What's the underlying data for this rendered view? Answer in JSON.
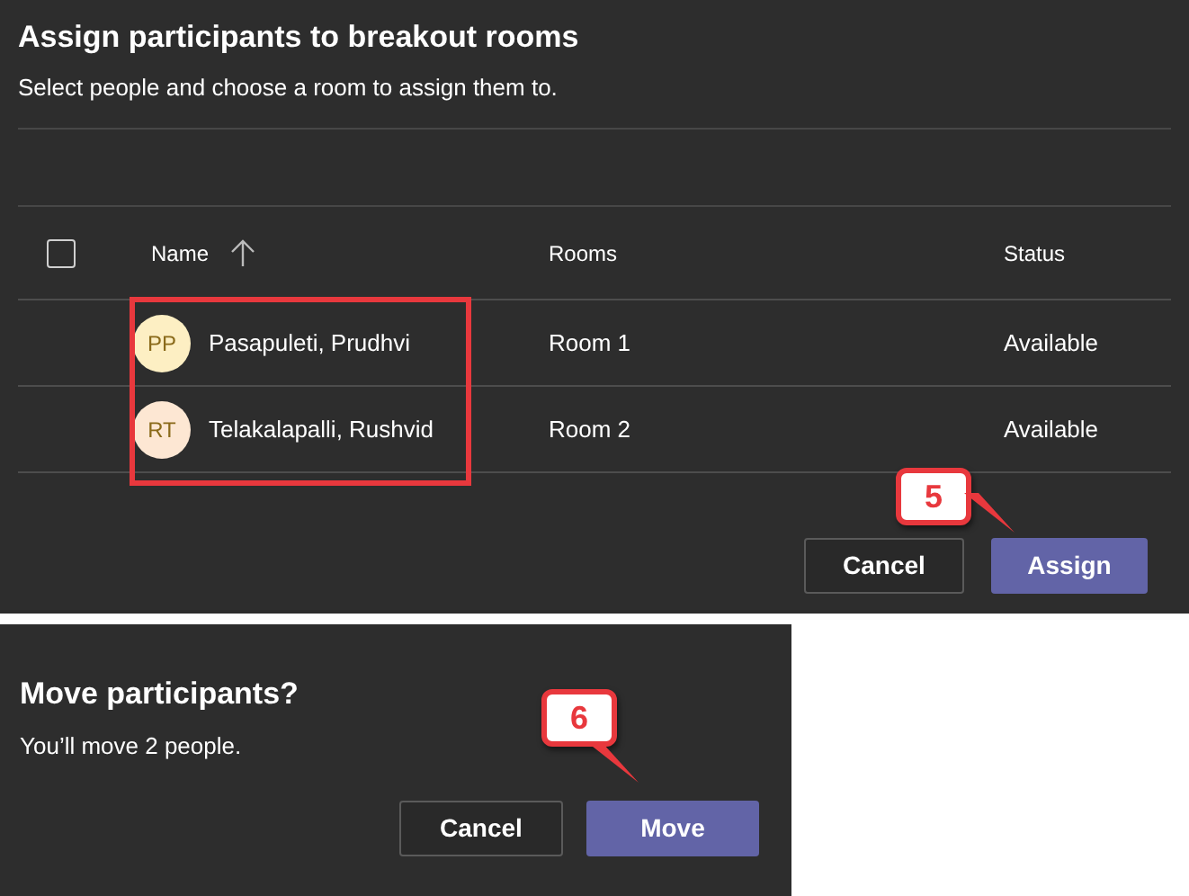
{
  "assign_dialog": {
    "title": "Assign participants to breakout rooms",
    "subtitle": "Select people and choose a room to assign them to.",
    "select_all": {
      "checked": false
    },
    "columns": [
      {
        "label": "Name",
        "sorted": true
      },
      {
        "label": "Rooms",
        "sorted": false
      },
      {
        "label": "Status",
        "sorted": false
      }
    ],
    "rows": [
      {
        "initials": "PP",
        "color": "#fdefc3",
        "name": "Pasapuleti, Prudhvi",
        "room": "Room 1",
        "status": "Available"
      },
      {
        "initials": "RT",
        "color": "#fde7d3",
        "name": "Telakalapalli, Rushvid",
        "room": "Room 2",
        "status": "Available"
      }
    ],
    "buttons": [
      {
        "label": "Cancel",
        "primary": false
      },
      {
        "label": "Assign",
        "primary": true
      }
    ],
    "callout": "5"
  },
  "move_dialog": {
    "title": "Move participants?",
    "message": "You’ll move 2 people.",
    "buttons": [
      {
        "label": "Cancel",
        "primary": false
      },
      {
        "label": "Move",
        "primary": true
      }
    ],
    "callout": "6"
  }
}
